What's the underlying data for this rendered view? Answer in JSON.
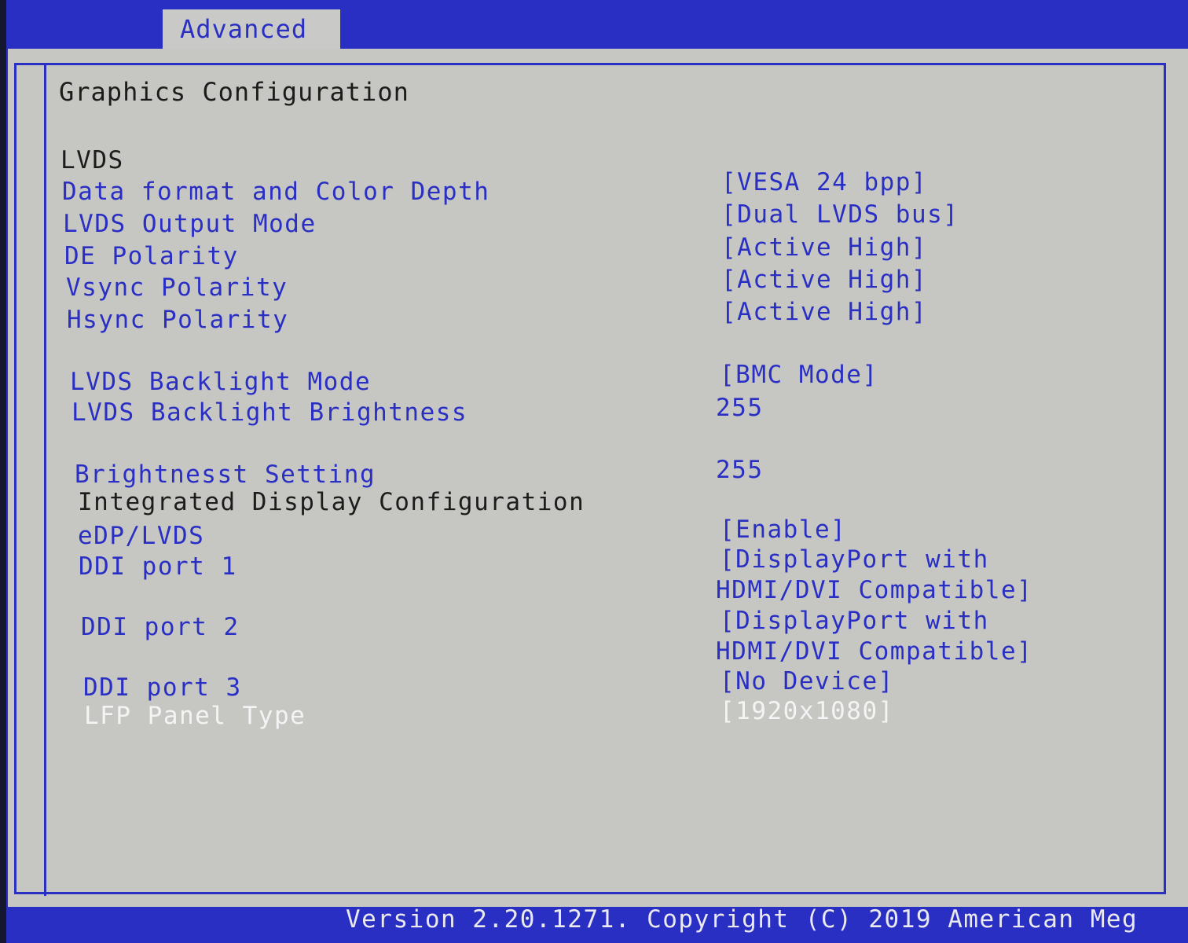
{
  "header": {
    "tab_label": "Advanced"
  },
  "section": {
    "title": "Graphics Configuration"
  },
  "lvds_heading": "LVDS",
  "settings": [
    {
      "label": "Data format and Color Depth",
      "value": "[VESA 24 bpp]"
    },
    {
      "label": "LVDS Output Mode",
      "value": "[Dual LVDS bus]"
    },
    {
      "label": "DE Polarity",
      "value": "[Active High]"
    },
    {
      "label": "Vsync Polarity",
      "value": "[Active High]"
    },
    {
      "label": "Hsync Polarity",
      "value": "[Active High]"
    },
    {
      "label": "LVDS Backlight Mode",
      "value": "[BMC Mode]"
    },
    {
      "label": "LVDS Backlight Brightness",
      "value": "255"
    },
    {
      "label": "Brightnesst Setting",
      "value": "255"
    }
  ],
  "integrated_heading": "Integrated Display Configuration",
  "display_settings": [
    {
      "label": "eDP/LVDS",
      "value": "[Enable]"
    },
    {
      "label": "DDI port 1",
      "value": "[DisplayPort with",
      "value_line2": "HDMI/DVI Compatible]"
    },
    {
      "label": "DDI port 2",
      "value": "[DisplayPort with",
      "value_line2": "HDMI/DVI Compatible]"
    },
    {
      "label": "DDI port 3",
      "value": "[No Device]"
    },
    {
      "label": "LFP Panel Type",
      "value": "[1920x1080]"
    }
  ],
  "footer": {
    "text": "Version 2.20.1271. Copyright (C) 2019 American Meg"
  },
  "colors": {
    "accent_blue": "#2a2fc4",
    "panel_gray": "#c6c7c3",
    "selected_text": "#f4f4f4"
  }
}
